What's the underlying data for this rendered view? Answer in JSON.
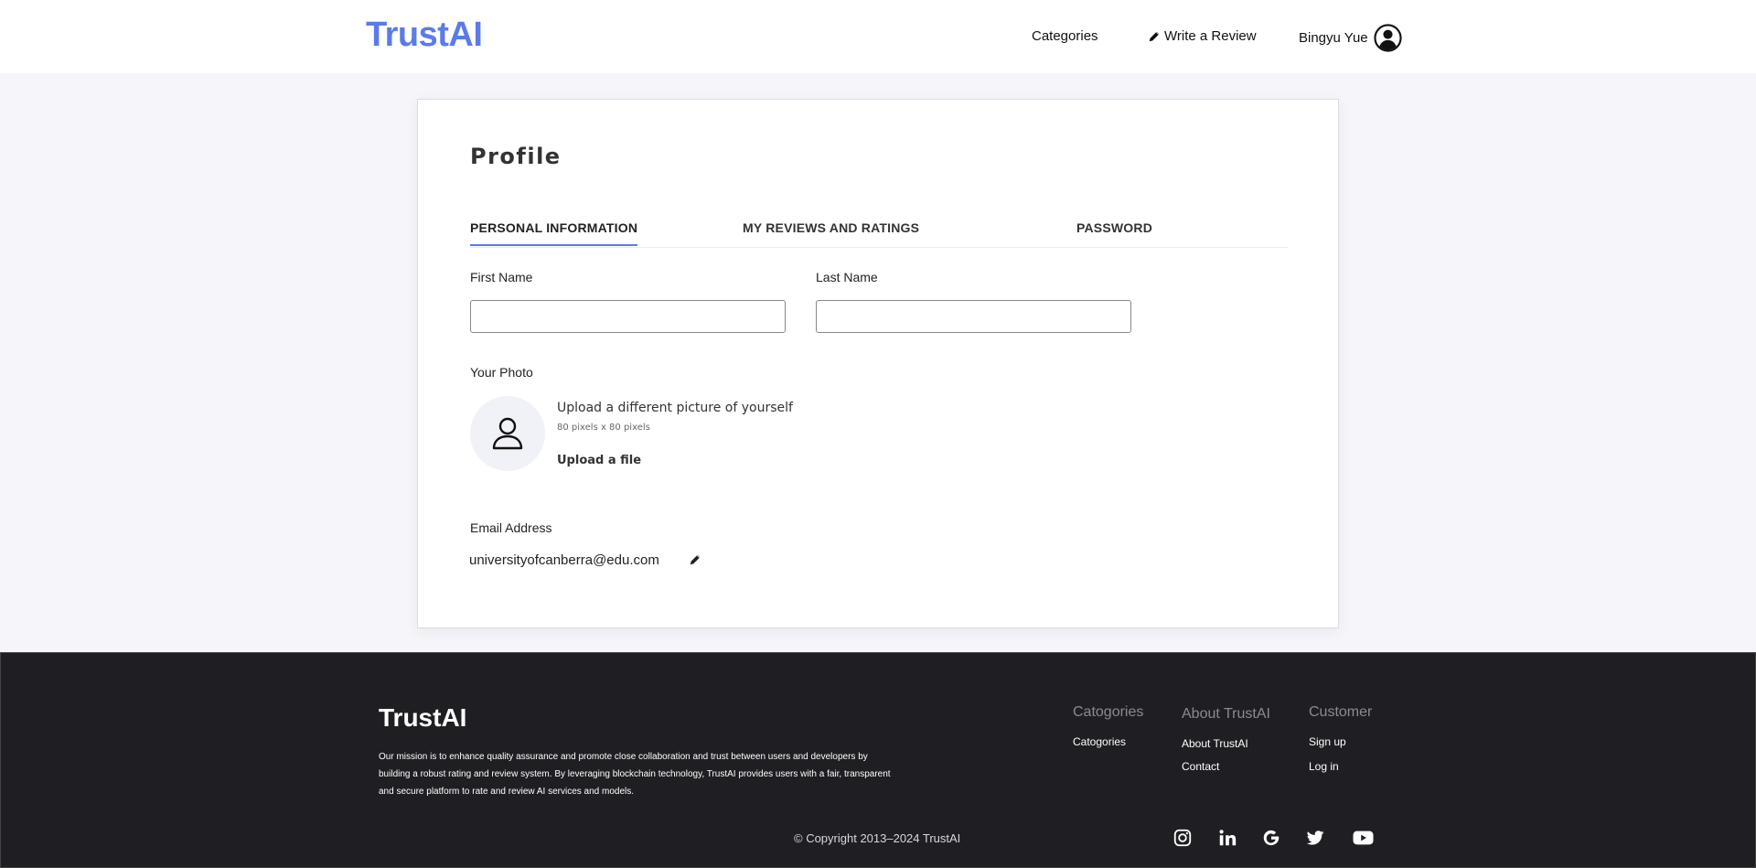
{
  "header": {
    "logo": "TrustAI",
    "nav_categories": "Categories",
    "nav_write_review": "Write a Review",
    "user_name": "Bingyu Yue"
  },
  "profile": {
    "title": "Profile",
    "tabs": [
      {
        "label": "PERSONAL INFORMATION",
        "active": true
      },
      {
        "label": "MY REVIEWS AND RATINGS",
        "active": false
      },
      {
        "label": "PASSWORD",
        "active": false
      }
    ],
    "first_name_label": "First Name",
    "first_name_value": "",
    "last_name_label": "Last Name",
    "last_name_value": "",
    "photo_label": "Your Photo",
    "upload_title": "Upload a different picture of yourself",
    "upload_size": "80 pixels x 80 pixels",
    "upload_link": "Upload a file",
    "email_label": "Email Address",
    "email_value": "universityofcanberra@edu.com"
  },
  "footer": {
    "logo": "TrustAI",
    "mission": "Our mission is to enhance quality assurance and promote close collaboration and trust between users and developers by building a robust rating and review system. By leveraging blockchain technology, TrustAI provides users with a fair, transparent and secure platform to rate and review AI services and models.",
    "columns": [
      {
        "title": "Catogories",
        "links": [
          "Catogories"
        ]
      },
      {
        "title": "About TrustAI",
        "links": [
          "About TrustAI",
          "Contact"
        ]
      },
      {
        "title": "Customer",
        "links": [
          "Sign up",
          "Log in"
        ]
      }
    ],
    "copyright": "© Copyright 2013–2024 TrustAI",
    "social_icons": [
      "instagram-icon",
      "linkedin-icon",
      "google-icon",
      "twitter-icon",
      "youtube-icon"
    ]
  },
  "colors": {
    "accent": "#5b7be9",
    "footer_bg": "#1f1f23",
    "page_bg": "#f5f5fa"
  }
}
